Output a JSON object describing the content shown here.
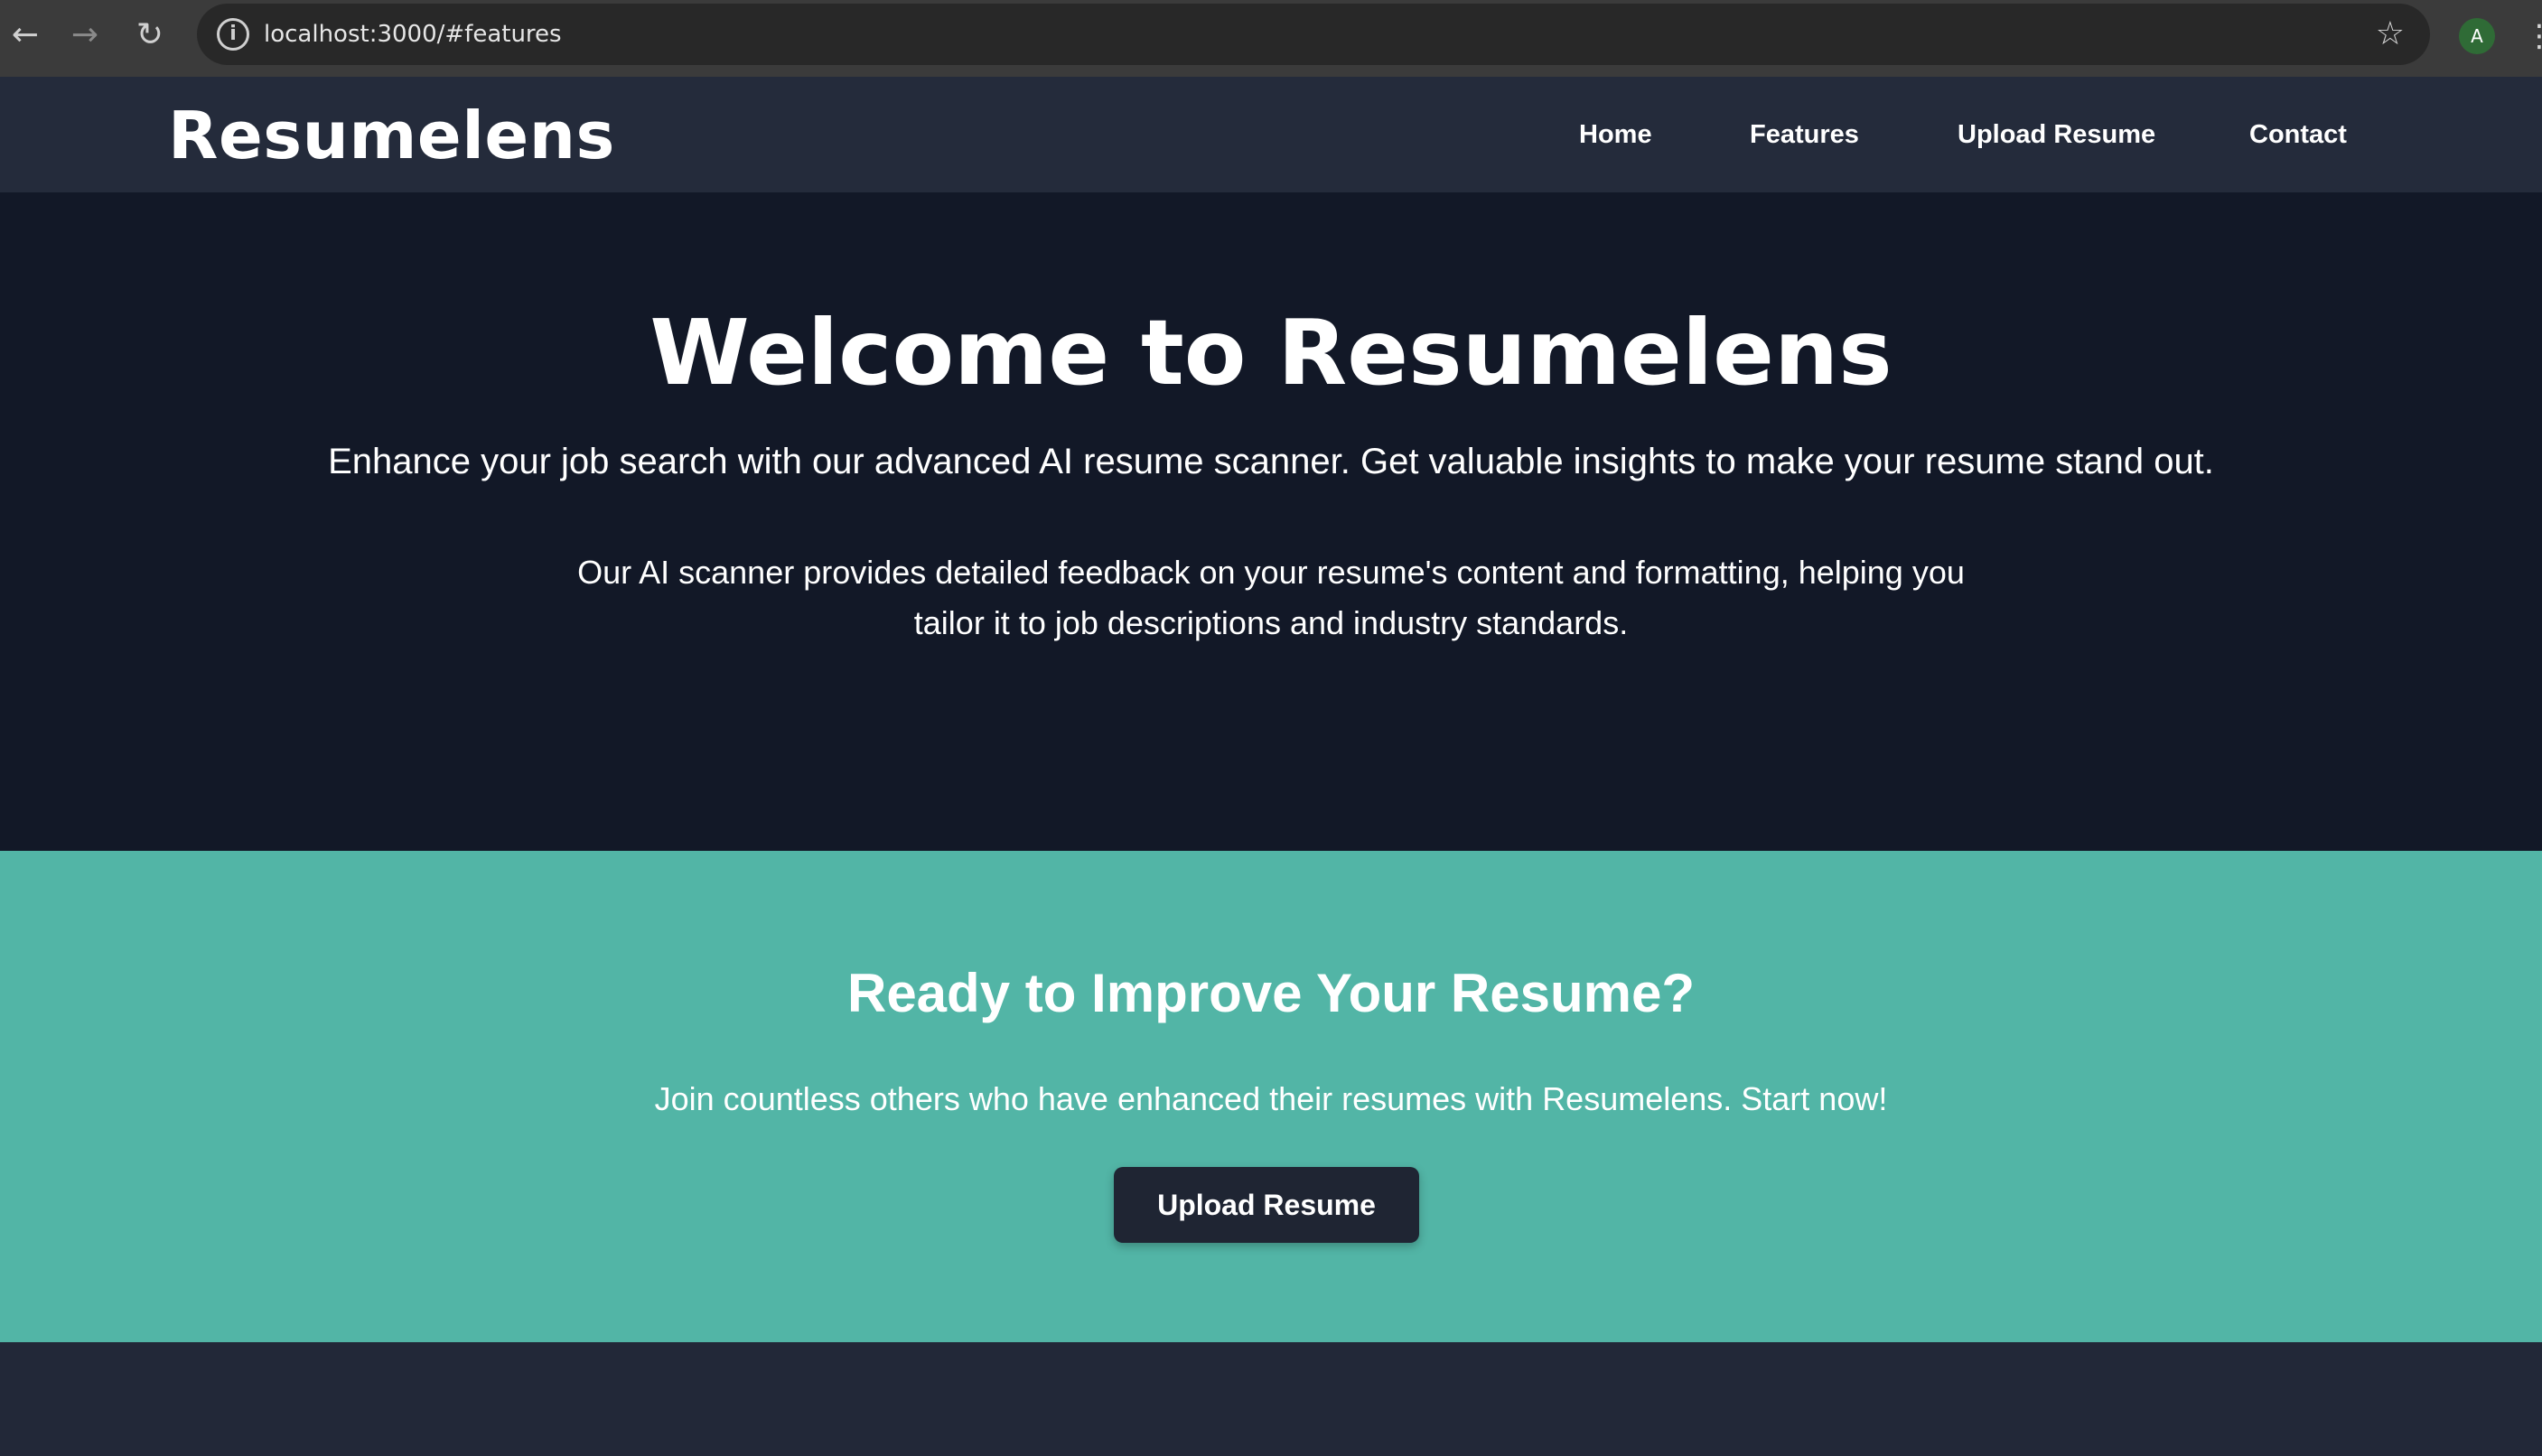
{
  "browser": {
    "back_icon": "←",
    "forward_icon": "→",
    "reload_icon": "↻",
    "info_icon": "i",
    "url": "localhost:3000/#features",
    "bookmark_icon": "☆",
    "profile_initial": "A",
    "menu_icon": "⋮"
  },
  "header": {
    "logo": "Resumelens",
    "nav": [
      "Home",
      "Features",
      "Upload Resume",
      "Contact"
    ]
  },
  "hero": {
    "title": "Welcome to Resumelens",
    "lead": "Enhance your job search with our advanced AI resume scanner. Get valuable insights to make your resume stand out.",
    "description": "Our AI scanner provides detailed feedback on your resume's content and formatting, helping you tailor it to job descriptions and industry standards."
  },
  "cta": {
    "title": "Ready to Improve Your Resume?",
    "text": "Join countless others who have enhanced their resumes with Resumelens. Start now!",
    "button": "Upload Resume"
  },
  "colors": {
    "header_bg": "#242b3b",
    "hero_bg": "#121827",
    "cta_bg": "#52b5a6",
    "button_bg": "#1f2533",
    "footer_bg": "#222838"
  }
}
